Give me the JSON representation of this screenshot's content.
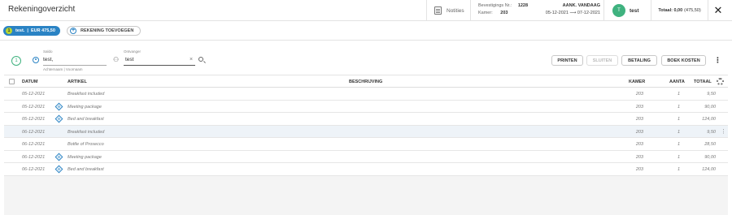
{
  "header": {
    "title": "Rekeningoverzicht",
    "notes_label": "Notities",
    "booking_label": "Bevestigings Nr.:",
    "booking_number": "1228",
    "room_label": "Kamer:",
    "room_number": "203",
    "arrival_status": "AANK. VANDAAG",
    "date_range": "05-12-2021 ⟶ 07-12-2021",
    "guest_initial": "T",
    "guest_name": "test",
    "total_label": "Totaal: 0,00",
    "total_paren": "(475,50)",
    "close_glyph": "✕"
  },
  "account_tabs": {
    "active": {
      "index": "1",
      "label": "test.  |  EUR 475,50"
    },
    "add_label": "REKENING TOEVOEGEN"
  },
  "toolbar": {
    "step": "1",
    "saldo_label": "Saldo",
    "saldo_value": "test,",
    "saldo_hint": "Achternaam | Voornaam",
    "recipient_label": "Ontvanger",
    "recipient_value": "test",
    "buttons": {
      "print": "PRINTEN",
      "close": "SLUITEN",
      "payment": "BETALING",
      "book": "BOEK KOSTEN"
    }
  },
  "table": {
    "columns": {
      "date": "DATUM",
      "article": "ARTIKEL",
      "description": "BESCHRIJVING",
      "room": "KAMER",
      "qty": "AANTA",
      "total": "TOTAAL"
    },
    "rows": [
      {
        "date": "05-12-2021",
        "article": "Breakfast included",
        "room": "203",
        "qty": "1",
        "total": "9,50"
      },
      {
        "date": "05-12-2021",
        "article": "Meeting package",
        "room": "203",
        "qty": "1",
        "total": "90,00"
      },
      {
        "date": "05-12-2021",
        "article": "Bed and breakfast",
        "room": "203",
        "qty": "1",
        "total": "124,00"
      },
      {
        "date": "06-12-2021",
        "article": "Breakfast included",
        "room": "203",
        "qty": "1",
        "total": "9,50"
      },
      {
        "date": "06-12-2021",
        "article": "Bottle of Prosecco",
        "room": "203",
        "qty": "1",
        "total": "28,50"
      },
      {
        "date": "06-12-2021",
        "article": "Meeting package",
        "room": "203",
        "qty": "1",
        "total": "90,00"
      },
      {
        "date": "06-12-2021",
        "article": "Bed and breakfast",
        "room": "203",
        "qty": "1",
        "total": "124,00"
      }
    ]
  },
  "colors": {
    "accent": "#2a83c4",
    "success": "#3fb27f",
    "badge": "#b9d52e"
  }
}
